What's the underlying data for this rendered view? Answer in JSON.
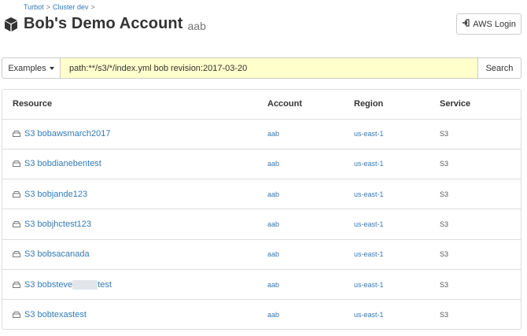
{
  "breadcrumb": {
    "items": [
      "Turbot",
      "Cluster dev"
    ],
    "separator": ">"
  },
  "header": {
    "title": "Bob's Demo Account",
    "account_id": "aab",
    "aws_login_label": "AWS Login"
  },
  "search": {
    "examples_label": "Examples",
    "query": "path:**/s3/*/index.yml bob revision:2017-03-20",
    "search_label": "Search"
  },
  "table": {
    "columns": [
      "Resource",
      "Account",
      "Region",
      "Service"
    ],
    "rows": [
      {
        "resource": "S3 bobawsmarch2017",
        "account": "aab",
        "region": "us-east-1",
        "service": "S3"
      },
      {
        "resource": "S3 bobdianebentest",
        "account": "aab",
        "region": "us-east-1",
        "service": "S3"
      },
      {
        "resource": "S3 bobjande123",
        "account": "aab",
        "region": "us-east-1",
        "service": "S3"
      },
      {
        "resource": "S3 bobjhctest123",
        "account": "aab",
        "region": "us-east-1",
        "service": "S3"
      },
      {
        "resource": "S3 bobsacanada",
        "account": "aab",
        "region": "us-east-1",
        "service": "S3"
      },
      {
        "resource_prefix": "S3 bobsteve",
        "resource_suffix": "test",
        "account": "aab",
        "region": "us-east-1",
        "service": "S3"
      },
      {
        "resource": "S3 bobtexastest",
        "account": "aab",
        "region": "us-east-1",
        "service": "S3"
      }
    ]
  },
  "colors": {
    "link": "#337ab7",
    "query_bg": "#ffffcc",
    "border": "#dddddd"
  },
  "icons": {
    "account": "cube-icon",
    "login": "sign-in-icon",
    "resource": "hdd-icon",
    "dropdown": "caret-down-icon"
  }
}
